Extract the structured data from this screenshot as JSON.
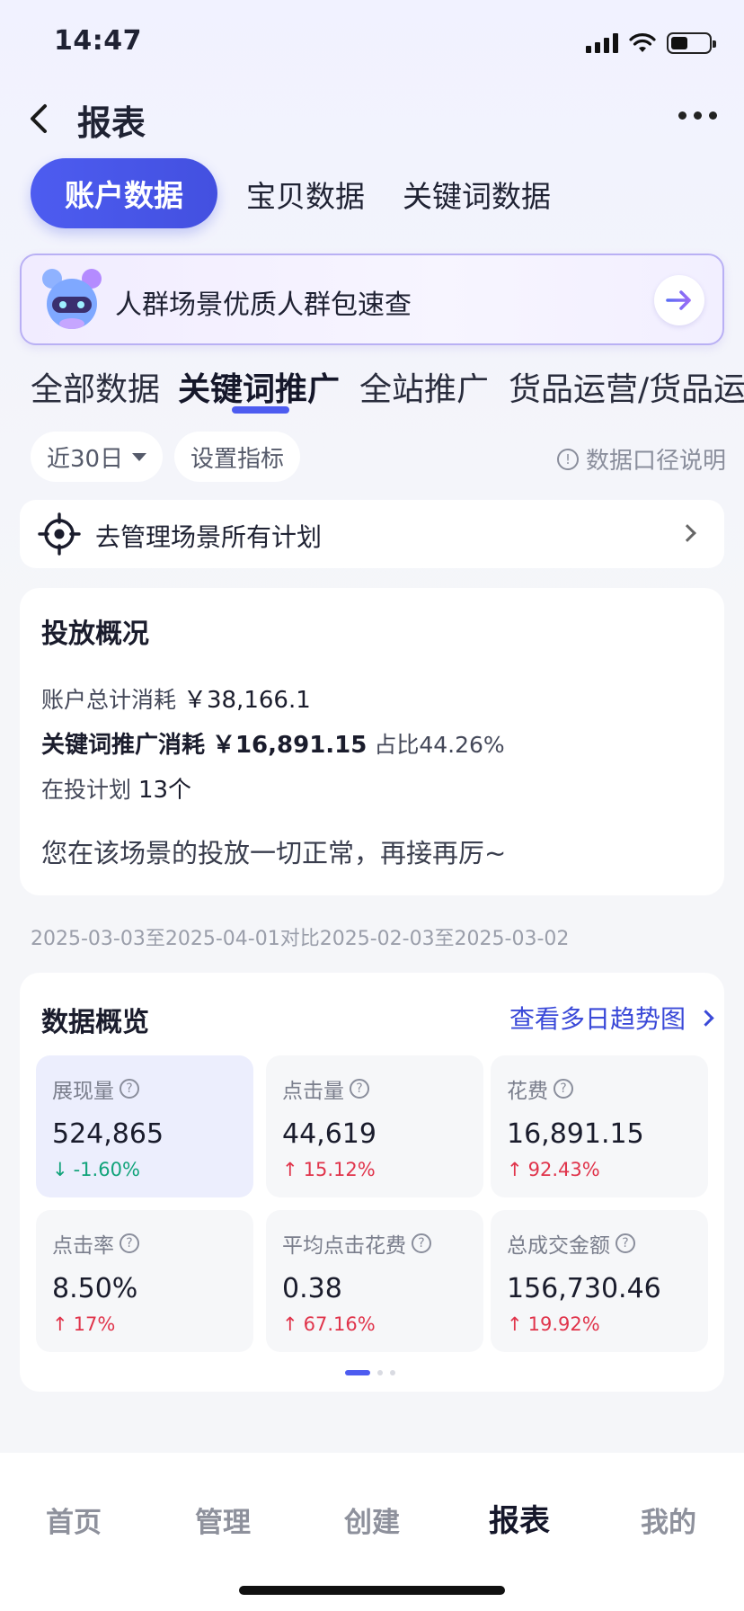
{
  "status_bar": {
    "time": "14:47"
  },
  "header": {
    "title": "报表"
  },
  "top_tabs": [
    "账户数据",
    "宝贝数据",
    "关键词数据"
  ],
  "banner": {
    "text": "人群场景优质人群包速查"
  },
  "sub_tabs": [
    "全部数据",
    "关键词推广",
    "全站推广",
    "货品运营/货品运"
  ],
  "filters": {
    "date_range": "近30日",
    "set_metrics": "设置指标",
    "explain": "数据口径说明",
    "info_glyph": "!"
  },
  "manage_row": {
    "text": "去管理场景所有计划"
  },
  "overview": {
    "title": "投放概况",
    "total_spend_label": "账户总计消耗",
    "total_spend_value": "￥38,166.1",
    "keyword_spend_label": "关键词推广消耗",
    "keyword_spend_value": "￥16,891.15",
    "keyword_share": "占比44.26%",
    "plans_label": "在投计划",
    "plans_value": "13个",
    "note": "您在该场景的投放一切正常，再接再厉~"
  },
  "compare_range": "2025-03-03至2025-04-01对比2025-02-03至2025-03-02",
  "data_overview": {
    "title": "数据概览",
    "trend_link": "查看多日趋势图",
    "help_glyph": "?",
    "metrics": [
      {
        "label": "展现量",
        "value": "524,865",
        "change": "-1.60%",
        "direction": "down",
        "arrow": "↓"
      },
      {
        "label": "点击量",
        "value": "44,619",
        "change": "15.12%",
        "direction": "up",
        "arrow": "↑"
      },
      {
        "label": "花费",
        "value": "16,891.15",
        "change": "92.43%",
        "direction": "up",
        "arrow": "↑"
      },
      {
        "label": "点击率",
        "value": "8.50%",
        "change": "17%",
        "direction": "up",
        "arrow": "↑"
      },
      {
        "label": "平均点击花费",
        "value": "0.38",
        "change": "67.16%",
        "direction": "up",
        "arrow": "↑"
      },
      {
        "label": "总成交金额",
        "value": "156,730.46",
        "change": "19.92%",
        "direction": "up",
        "arrow": "↑"
      }
    ],
    "page_indicator": {
      "count": 3,
      "active": 1
    }
  },
  "bottom_nav": [
    "首页",
    "管理",
    "创建",
    "报表",
    "我的"
  ],
  "colors": {
    "accent": "#4d5cf0",
    "up": "#e0344b",
    "down": "#11a37a",
    "link": "#3a49d8"
  },
  "icons": [
    "back-arrow-icon",
    "more-dots-icon",
    "mascot-icon",
    "arrow-right-icon",
    "crosshair-icon",
    "chevron-right-icon",
    "question-circle-icon",
    "info-circle-icon"
  ]
}
